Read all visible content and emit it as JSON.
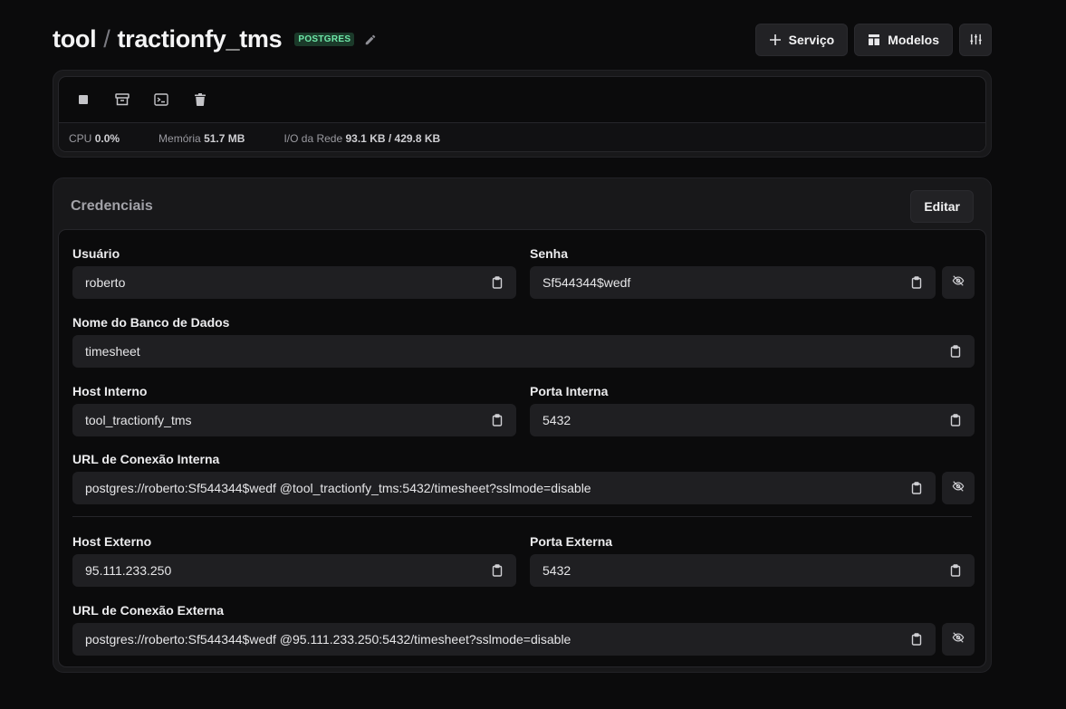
{
  "header": {
    "project": "tool",
    "separator": "/",
    "service": "tractionfy_tms",
    "badge": "POSTGRES",
    "edit_icon": "pencil-icon",
    "buttons": {
      "service_label": "Serviço",
      "models_label": "Modelos",
      "settings_icon": "sliders-icon"
    }
  },
  "controls": {
    "icons": [
      "stop-icon",
      "archive-icon",
      "terminal-icon",
      "trash-icon"
    ]
  },
  "stats": {
    "cpu_label": "CPU",
    "cpu_value": "0.0%",
    "memory_label": "Memória",
    "memory_value": "51.7 MB",
    "network_label": "I/O da Rede",
    "network_value": "93.1 KB / 429.8 KB"
  },
  "credentials": {
    "title": "Credenciais",
    "edit_label": "Editar",
    "user": {
      "label": "Usuário",
      "value": "roberto"
    },
    "password": {
      "label": "Senha",
      "value": "Sf544344$wedf"
    },
    "database": {
      "label": "Nome do Banco de Dados",
      "value": "timesheet"
    },
    "internal_host": {
      "label": "Host Interno",
      "value": "tool_tractionfy_tms"
    },
    "internal_port": {
      "label": "Porta Interna",
      "value": "5432"
    },
    "internal_url": {
      "label": "URL de Conexão Interna",
      "value": "postgres://roberto:Sf544344$wedf @tool_tractionfy_tms:5432/timesheet?sslmode=disable"
    },
    "external_host": {
      "label": "Host Externo",
      "value": "95.111.233.250"
    },
    "external_port": {
      "label": "Porta Externa",
      "value": "5432"
    },
    "external_url": {
      "label": "URL de Conexão Externa",
      "value": "postgres://roberto:Sf544344$wedf @95.111.233.250:5432/timesheet?sslmode=disable"
    }
  },
  "colors": {
    "background": "#0b0b0c",
    "panel": "#18181a",
    "input": "#1f1f22",
    "badge_bg": "#1b3a2a",
    "badge_text": "#6ee7a8"
  }
}
